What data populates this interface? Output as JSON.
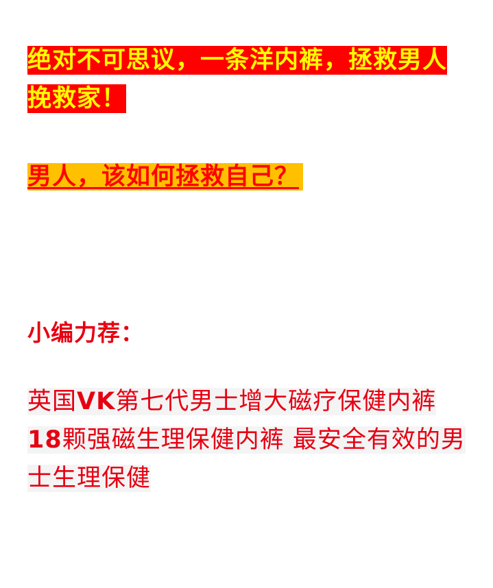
{
  "headline": {
    "text": "绝对不可思议，一条洋内裤，拯救男人挽救家！"
  },
  "subhead": {
    "text": "男人，该如何拯救自己？"
  },
  "recommend": {
    "label": "小编力荐："
  },
  "product": {
    "line1_prefix": "英国",
    "line1_bold": "VK",
    "line1_suffix": "第七代男士增大磁疗保健内裤",
    "line2_bold": "18",
    "line2_suffix": "颗强磁生理保健内裤 最安全有效的男士生理保健"
  },
  "colors": {
    "headline_bg": "#ff0000",
    "headline_text": "#ffff00",
    "subhead_bg": "#ffc000",
    "subhead_text": "#ff0000",
    "accent_red": "#e60012",
    "product_bg": "#f4f4f4"
  }
}
